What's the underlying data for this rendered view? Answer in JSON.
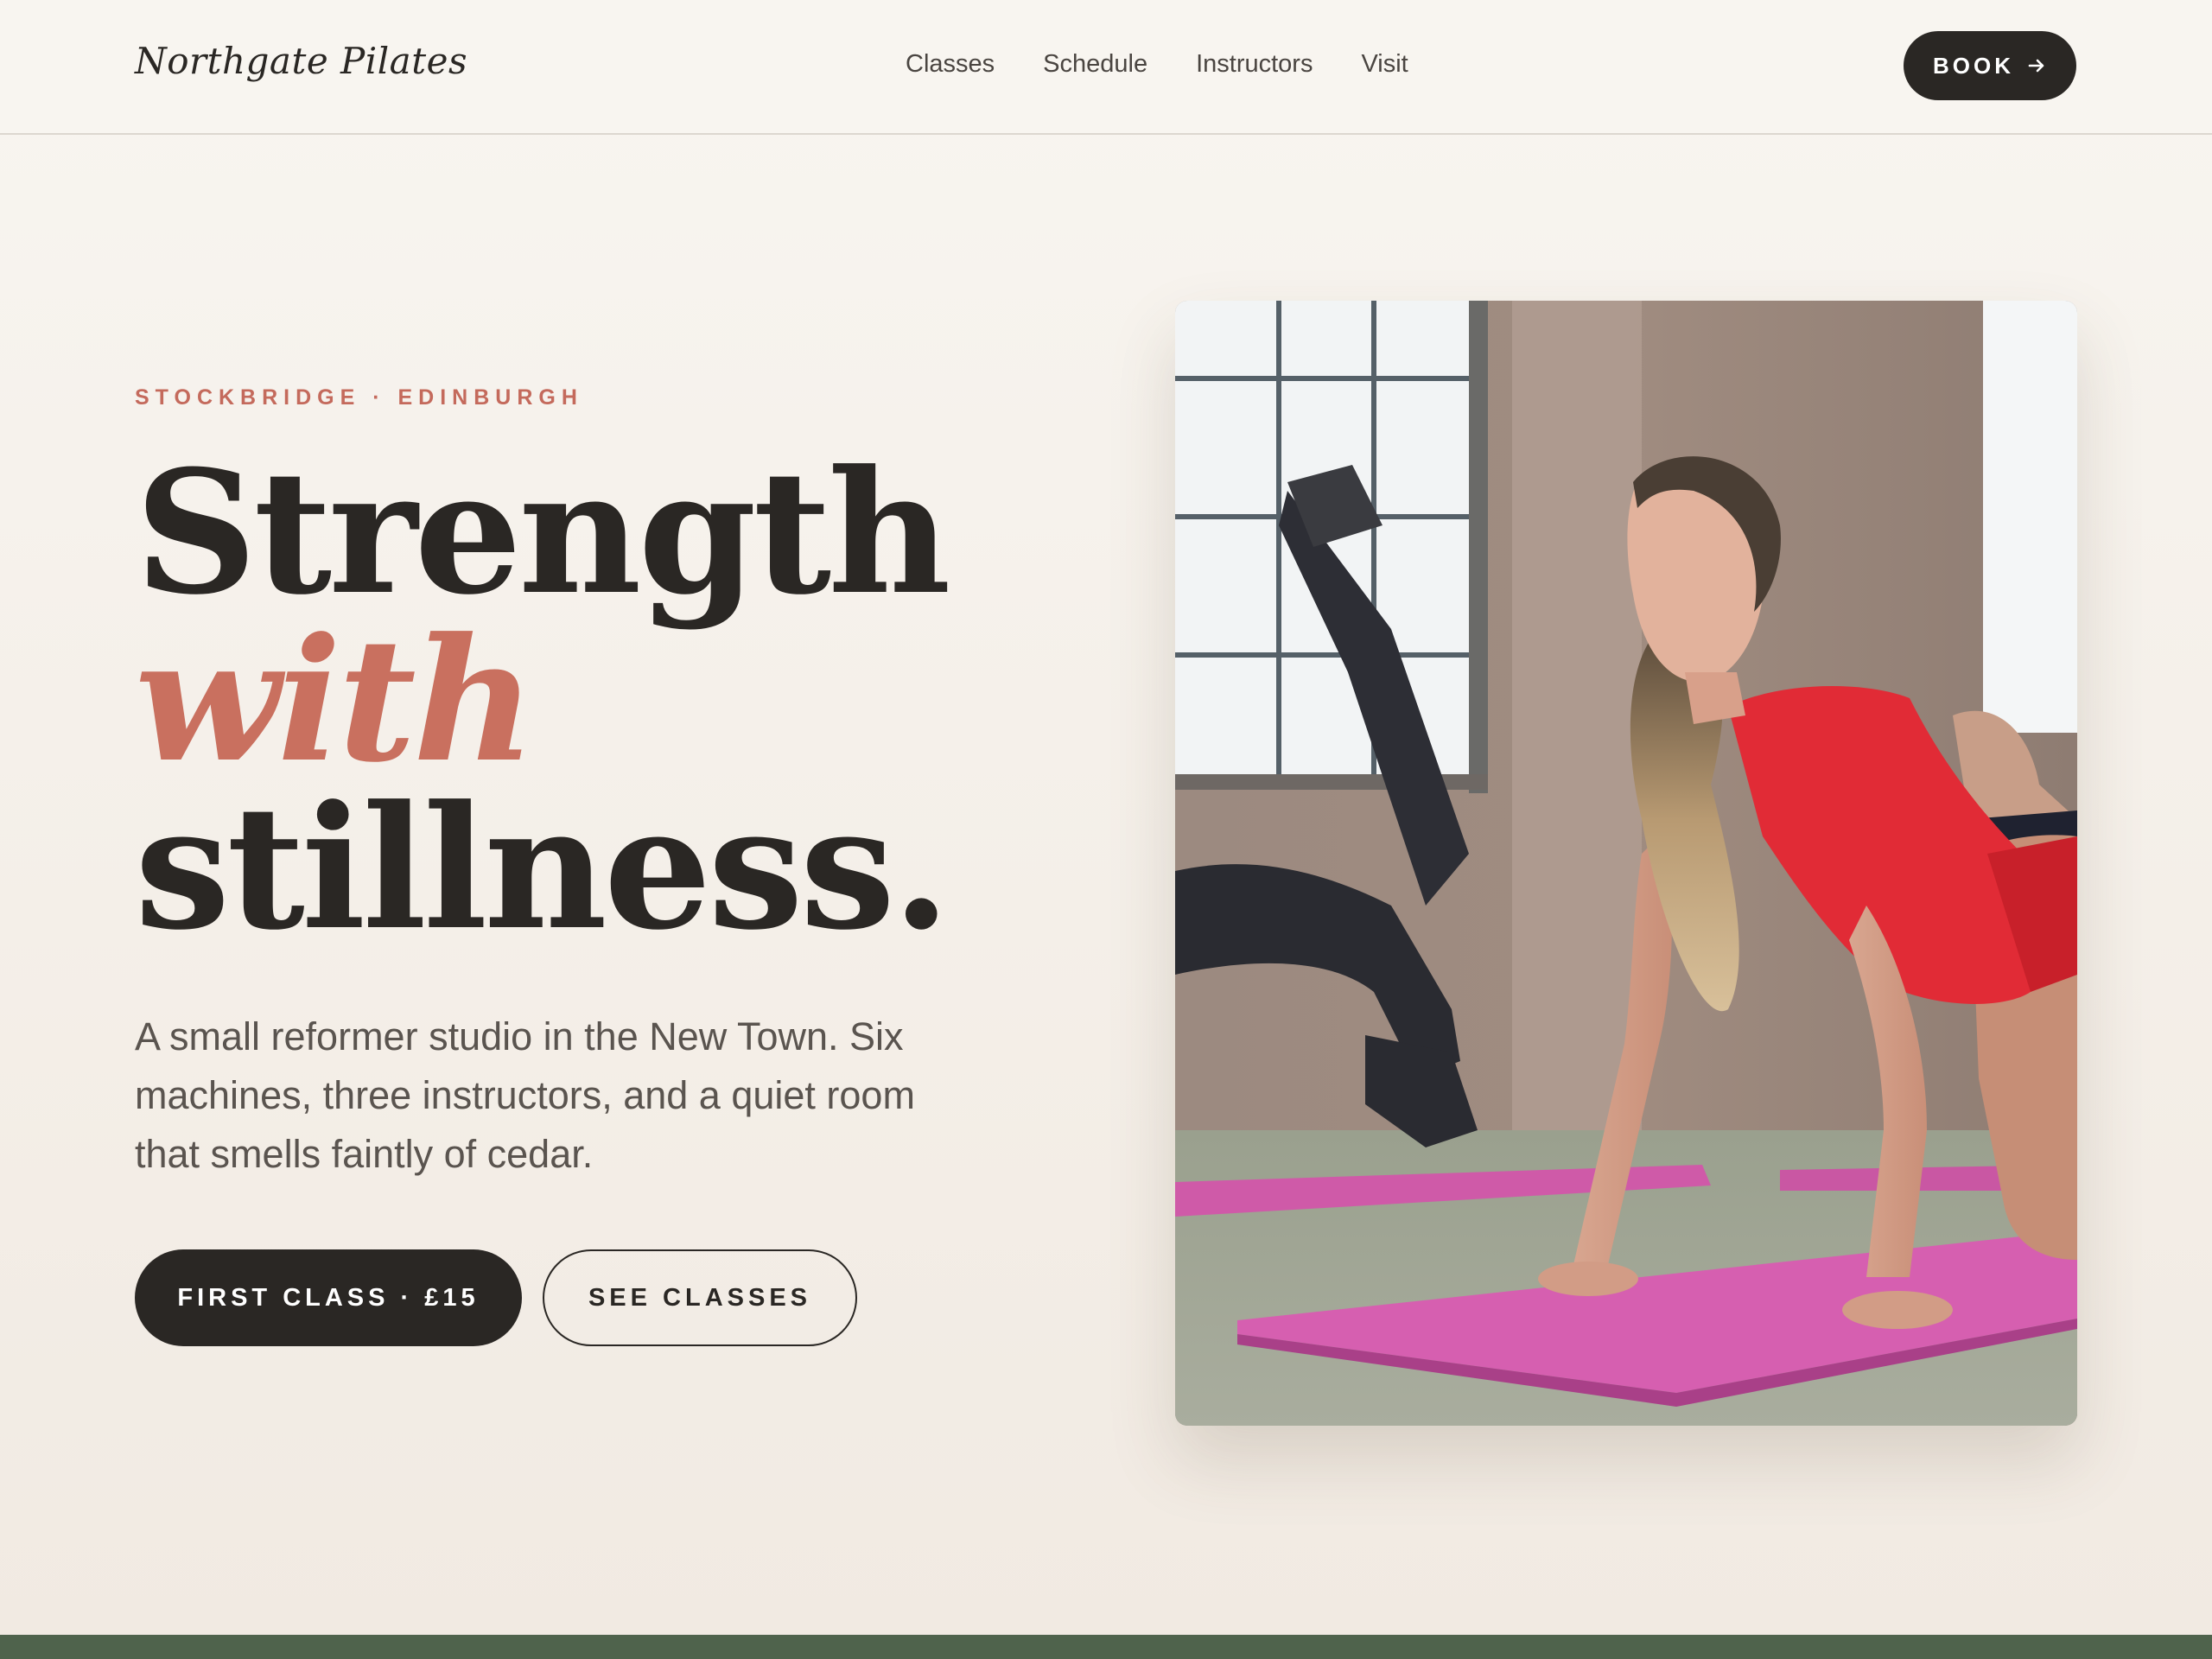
{
  "brand": {
    "name": "Northgate Pilates"
  },
  "nav": {
    "items": [
      {
        "label": "Classes"
      },
      {
        "label": "Schedule"
      },
      {
        "label": "Instructors"
      },
      {
        "label": "Visit"
      }
    ],
    "book_label": "BOOK",
    "book_icon": "arrow-right-icon"
  },
  "hero": {
    "eyebrow": "STOCKBRIDGE · EDINBURGH",
    "headline_line1": "Strength",
    "headline_line2": "with",
    "headline_line3": "stillness.",
    "lede": "A small reformer studio in the New Town. Six machines, three instructors, and a quiet room that smells faintly of cedar.",
    "primary_cta": "FIRST CLASS · £15",
    "secondary_cta": "SEE CLASSES"
  },
  "colors": {
    "accent": "#c9705f",
    "ink": "#2a2724",
    "background": "#f8f5f0",
    "footer_band": "#4f634c"
  }
}
